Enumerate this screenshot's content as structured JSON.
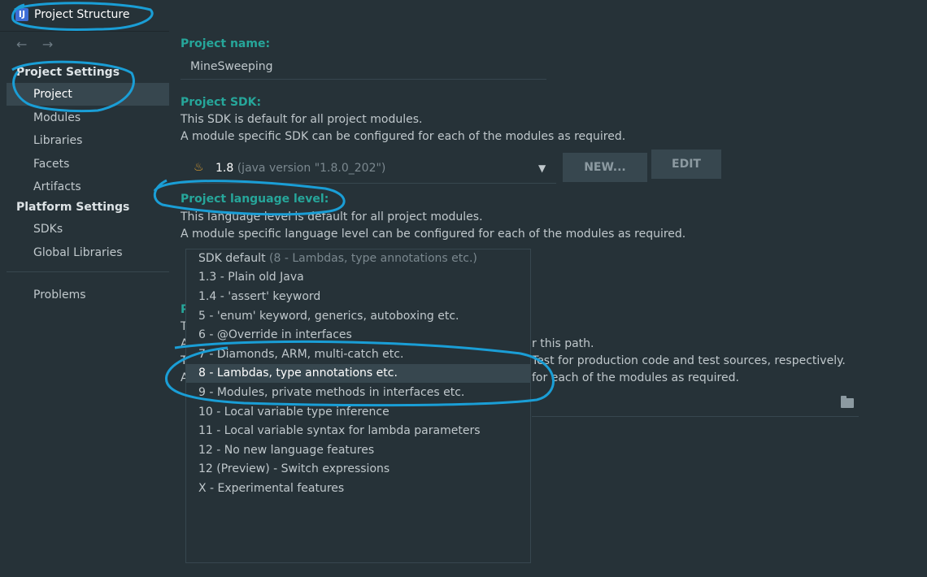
{
  "window": {
    "title": "Project Structure",
    "app_icon": "intellij-app-icon"
  },
  "nav": {
    "back": "←",
    "forward": "→"
  },
  "sidebar": {
    "project_settings_header": "Project Settings",
    "platform_settings_header": "Platform Settings",
    "items": [
      {
        "label": "Project",
        "selected": true
      },
      {
        "label": "Modules"
      },
      {
        "label": "Libraries"
      },
      {
        "label": "Facets"
      },
      {
        "label": "Artifacts"
      }
    ],
    "platform_items": [
      {
        "label": "SDKs"
      },
      {
        "label": "Global Libraries"
      }
    ],
    "problems": "Problems"
  },
  "project": {
    "name_label": "Project name:",
    "name_value": "MineSweeping",
    "sdk_label": "Project SDK:",
    "sdk_desc1": "This SDK is default for all project modules.",
    "sdk_desc2": "A module specific SDK can be configured for each of the modules as required.",
    "sdk_value": "1.8",
    "sdk_hint": "(java version \"1.8.0_202\")",
    "new_button": "NEW...",
    "edit_button": "EDIT",
    "lang_label": "Project language level:",
    "lang_desc1": "This language level is default for all project modules.",
    "lang_desc2": "A module specific language level can be configured for each of the modules as required.",
    "partial_label": "P",
    "partial_text_1": "T",
    "partial_text_2": "A",
    "partial_text_3": "T",
    "partial_text_4": "A",
    "compiler_path_tail": "r this path.",
    "compiler_tail2": "Test for production code and test sources, respectively.",
    "compiler_tail3": "for each of the modules as required."
  },
  "language_levels": [
    {
      "label": "SDK default",
      "hint": "(8 - Lambdas, type annotations etc.)"
    },
    {
      "label": "1.3 - Plain old Java"
    },
    {
      "label": "1.4 - 'assert' keyword"
    },
    {
      "label": "5 - 'enum' keyword, generics, autoboxing etc."
    },
    {
      "label": "6 - @Override in interfaces"
    },
    {
      "label": "7 - Diamonds, ARM, multi-catch etc."
    },
    {
      "label": "8 - Lambdas, type annotations etc.",
      "selected": true
    },
    {
      "label": "9 - Modules, private methods in interfaces etc."
    },
    {
      "label": "10 - Local variable type inference"
    },
    {
      "label": "11 - Local variable syntax for lambda parameters"
    },
    {
      "label": "12 - No new language features"
    },
    {
      "label": "12 (Preview) - Switch expressions"
    },
    {
      "label": "X - Experimental features"
    }
  ],
  "colors": {
    "background": "#263238",
    "accent_teal": "#26a69a",
    "annotation": "#1a9ed6",
    "selection": "#37474f"
  }
}
